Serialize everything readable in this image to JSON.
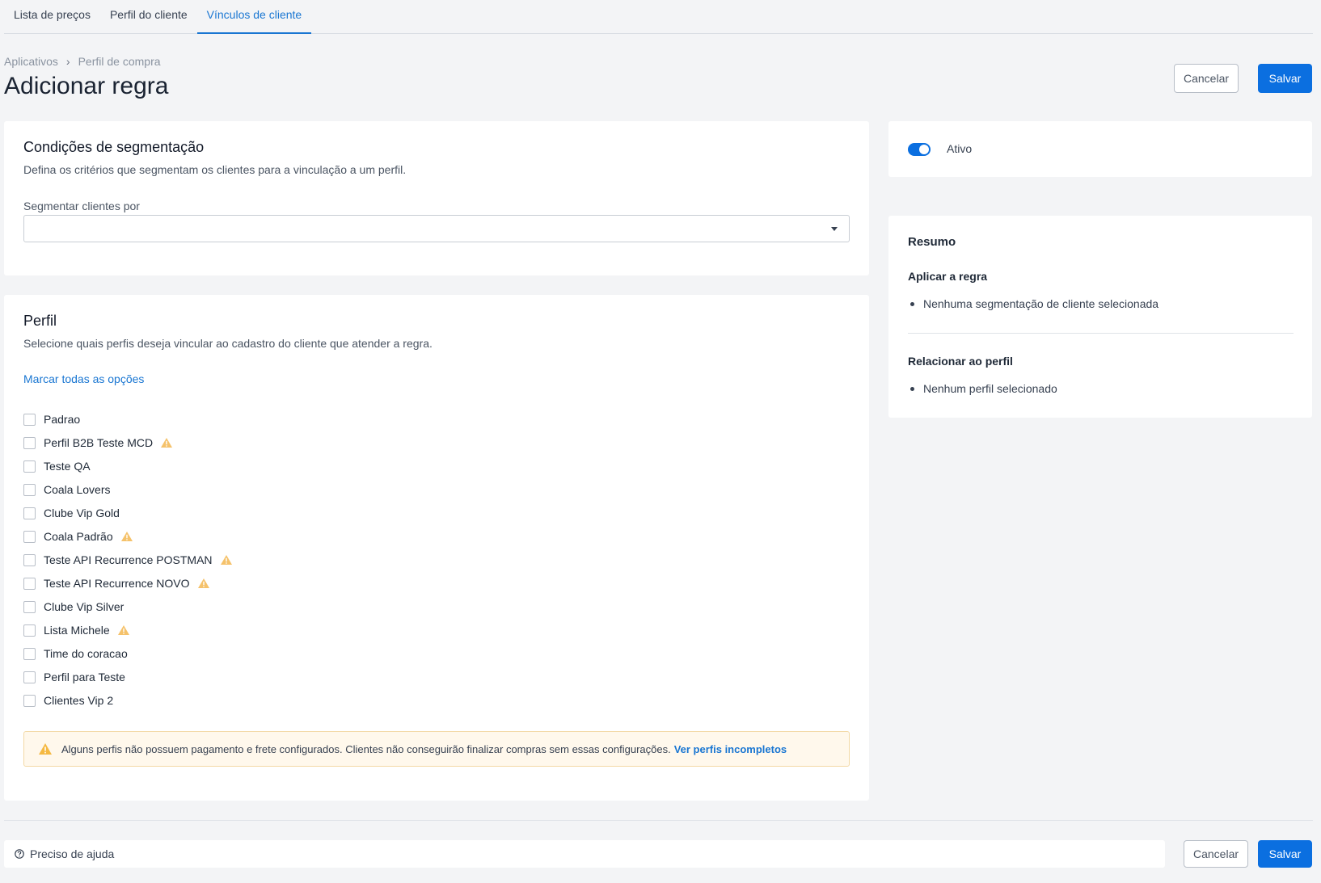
{
  "tabs": [
    {
      "label": "Lista de preços"
    },
    {
      "label": "Perfil do cliente"
    },
    {
      "label": "Vínculos de cliente"
    }
  ],
  "breadcrumb": {
    "items": [
      "Aplicativos",
      "Perfil de compra"
    ],
    "separator": "›"
  },
  "page": {
    "title": "Adicionar regra"
  },
  "header_actions": {
    "cancel_label": "Cancelar",
    "save_label": "Salvar"
  },
  "segmentation": {
    "title": "Condições de segmentação",
    "description": "Defina os critérios que segmentam os clientes para a vinculação a um perfil.",
    "field_label": "Segmentar clientes por",
    "selected_value": ""
  },
  "profile": {
    "title": "Perfil",
    "description": "Selecione quais perfis deseja vincular ao cadastro do cliente que atender a regra.",
    "select_all_label": "Marcar todas as opções",
    "options": [
      {
        "label": "Padrao",
        "warning": false,
        "checked": false
      },
      {
        "label": "Perfil B2B Teste MCD",
        "warning": true,
        "checked": false
      },
      {
        "label": "Teste QA",
        "warning": false,
        "checked": false
      },
      {
        "label": "Coala Lovers",
        "warning": false,
        "checked": false
      },
      {
        "label": "Clube Vip Gold",
        "warning": false,
        "checked": false
      },
      {
        "label": "Coala Padrão",
        "warning": true,
        "checked": false
      },
      {
        "label": "Teste API Recurrence POSTMAN",
        "warning": true,
        "checked": false
      },
      {
        "label": "Teste API Recurrence NOVO",
        "warning": true,
        "checked": false
      },
      {
        "label": "Clube Vip Silver",
        "warning": false,
        "checked": false
      },
      {
        "label": "Lista Michele",
        "warning": true,
        "checked": false
      },
      {
        "label": "Time do coracao",
        "warning": false,
        "checked": false
      },
      {
        "label": "Perfil para Teste",
        "warning": false,
        "checked": false
      },
      {
        "label": "Clientes Vip 2",
        "warning": false,
        "checked": false
      }
    ],
    "alert": {
      "text": "Alguns perfis não possuem pagamento e frete configurados. Clientes não conseguirão finalizar compras sem essas configurações.",
      "link_label": "Ver perfis incompletos"
    }
  },
  "status": {
    "label": "Ativo",
    "enabled": true
  },
  "summary": {
    "title": "Resumo",
    "apply_heading": "Aplicar a regra",
    "apply_item": "Nenhuma segmentação de cliente selecionada",
    "relate_heading": "Relacionar ao perfil",
    "relate_item": "Nenhum perfil selecionado"
  },
  "footer": {
    "help_label": "Preciso de ajuda",
    "cancel_label": "Cancelar",
    "save_label": "Salvar"
  },
  "colors": {
    "accent": "#0b6fe0",
    "warning": "#f5b942",
    "background": "#f3f4f6"
  },
  "icons": {
    "warning": "warning-triangle-icon",
    "help": "help-circle-icon",
    "select": "caret-down-icon"
  }
}
